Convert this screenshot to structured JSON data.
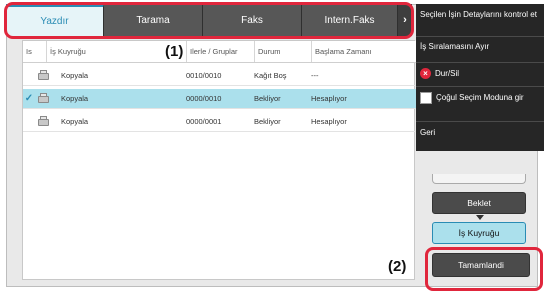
{
  "tabs": [
    {
      "label": "Yazdır",
      "active": true
    },
    {
      "label": "Tarama",
      "active": false
    },
    {
      "label": "Faks",
      "active": false
    },
    {
      "label": "Intern.Faks",
      "active": false
    }
  ],
  "tab_more_glyph": "›",
  "table": {
    "columns": [
      "Is",
      "İş Kuyruğu",
      "Ilerle / Gruplar",
      "Durum",
      "Başlama Zamanı"
    ],
    "rows": [
      {
        "selected": false,
        "icon": "copier-icon",
        "name": "Kopyala",
        "progress": "0010/0010",
        "status": "Kağıt Boş",
        "start": "---"
      },
      {
        "selected": true,
        "icon": "copier-icon",
        "name": "Kopyala",
        "progress": "0000/0010",
        "status": "Bekliyor",
        "start": "Hesaplıyor"
      },
      {
        "selected": false,
        "icon": "copier-icon",
        "name": "Kopyala",
        "progress": "0000/0001",
        "status": "Bekliyor",
        "start": "Hesaplıyor"
      }
    ]
  },
  "side_menu": {
    "details": "Seçilen İşin Detaylarını kontrol et",
    "separate": "İş Sıralamasını Ayır",
    "stop_delete": "Dur/Sil",
    "multi_select": "Çoğul Seçim Moduna gir",
    "back": "Geri"
  },
  "buttons": {
    "hold": "Beklet",
    "job_queue": "İş Kuyruğu",
    "completed": "Tamamlandi"
  },
  "callouts": {
    "one": "(1)",
    "two": "(2)"
  },
  "colors": {
    "accent": "#2a8cb4",
    "highlight_row": "#abe0ec",
    "callout_red": "#e0263c",
    "menu_bg": "#262626"
  }
}
